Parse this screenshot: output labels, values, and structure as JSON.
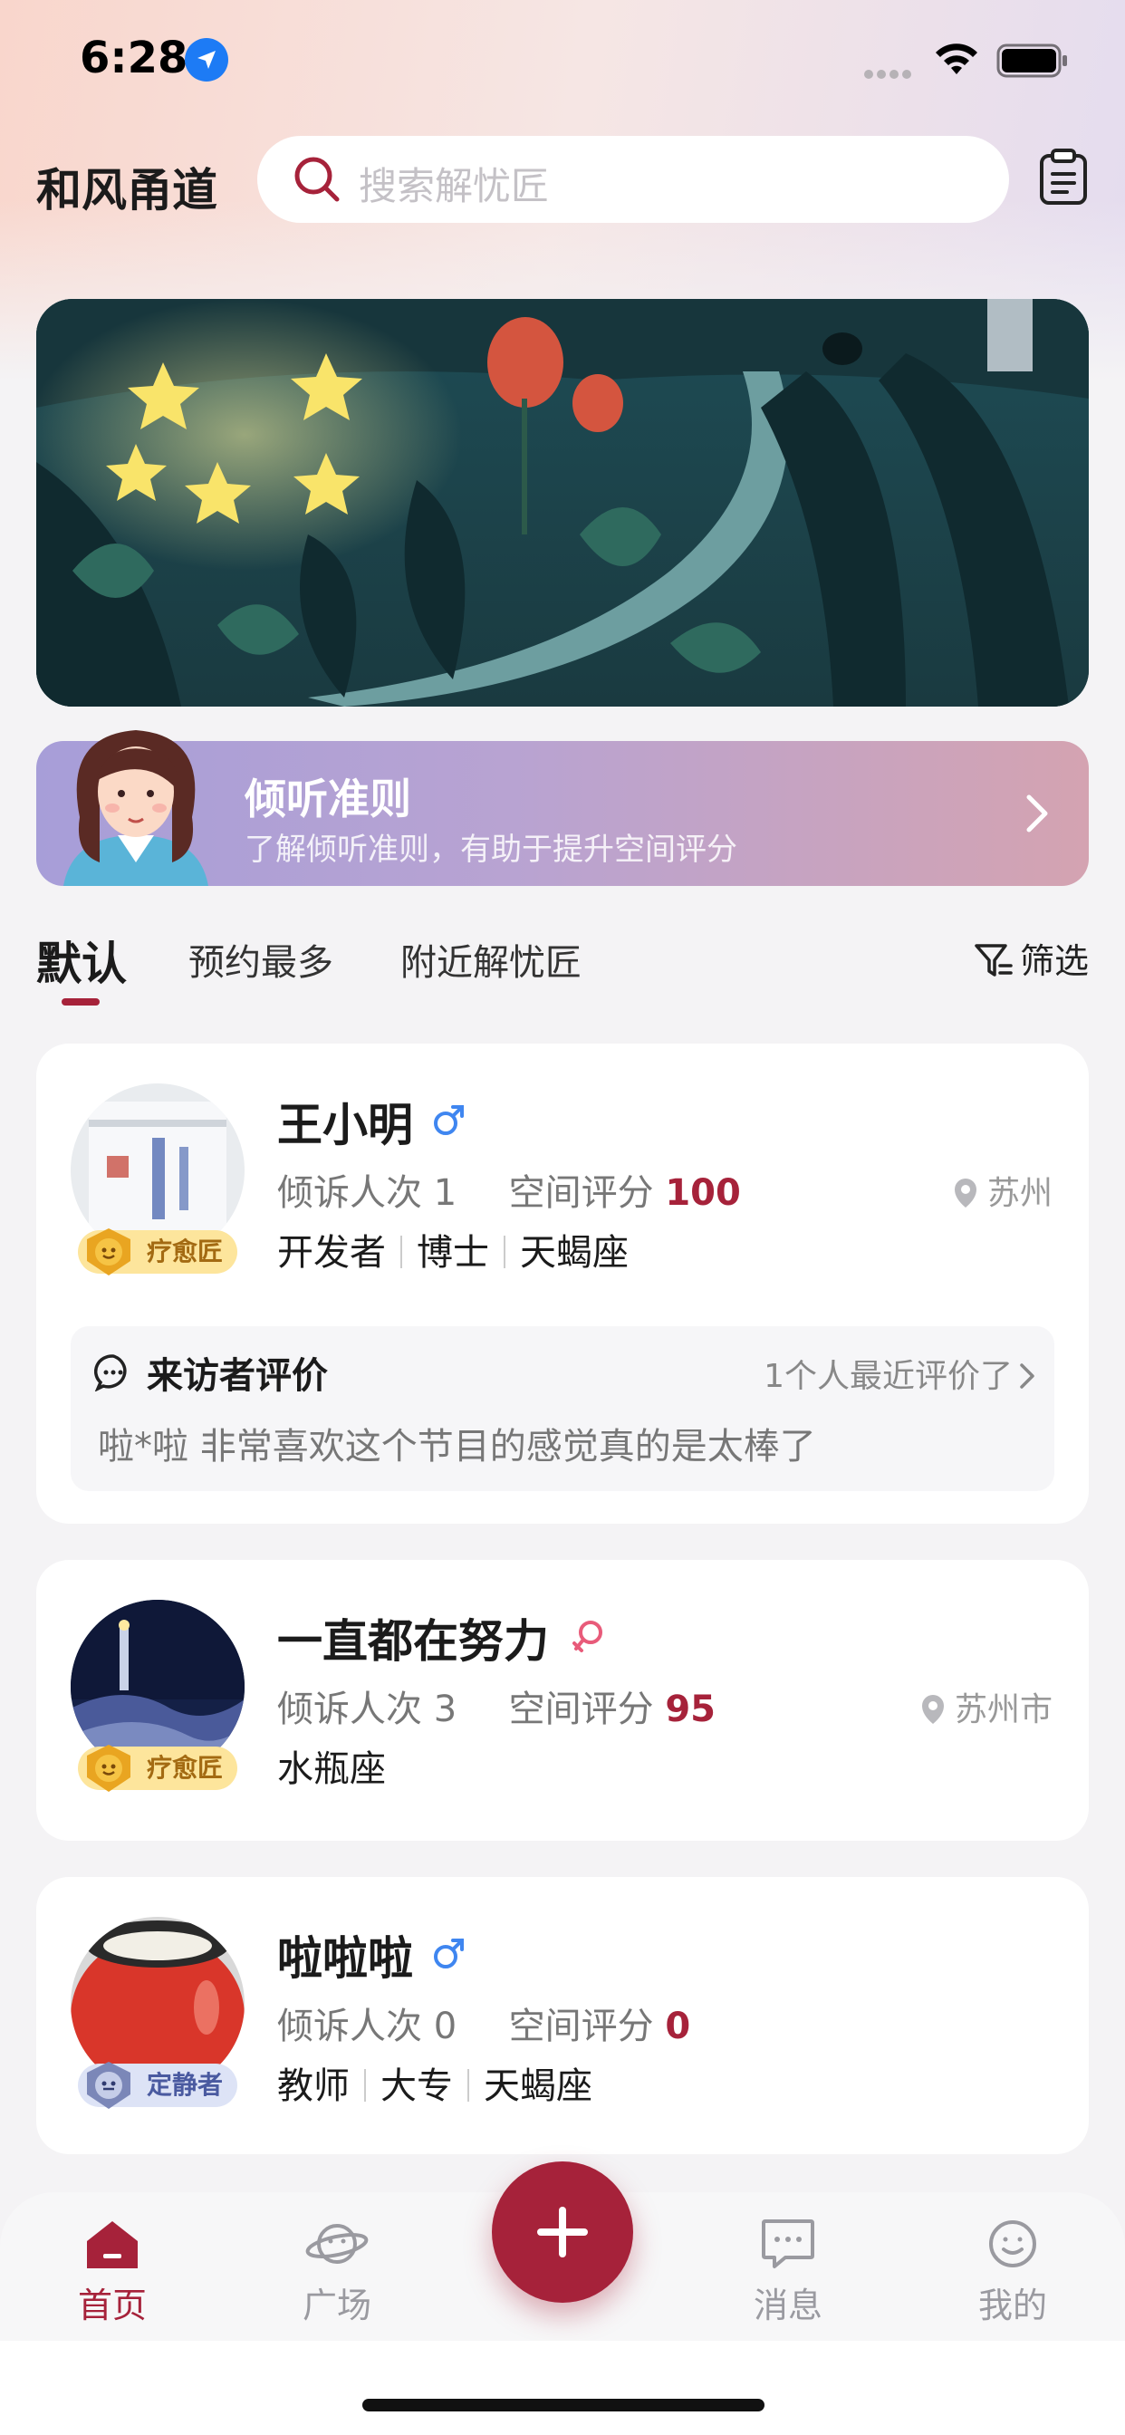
{
  "status_bar": {
    "time": "6:28"
  },
  "header": {
    "app_title": "和风甬道",
    "search_placeholder": "搜索解忧匠"
  },
  "guide_card": {
    "title": "倾听准则",
    "subtitle": "了解倾听准则，有助于提升空间评分"
  },
  "tabs": {
    "items": [
      "默认",
      "预约最多",
      "附近解忧匠"
    ],
    "active_index": 0,
    "filter_label": "筛选"
  },
  "labels": {
    "talk_count": "倾诉人次",
    "space_score": "空间评分"
  },
  "listeners": [
    {
      "name": "王小明",
      "gender": "male",
      "badge": "疗愈匠",
      "talk_count": "1",
      "score": "100",
      "location": "苏州",
      "tags": [
        "开发者",
        "博士",
        "天蝎座"
      ],
      "review": {
        "title": "来访者评价",
        "count_text": "1个人最近评价了",
        "text": "啦*啦 非常喜欢这个节目的感觉真的是太棒了"
      }
    },
    {
      "name": "一直都在努力",
      "gender": "female",
      "badge": "疗愈匠",
      "talk_count": "3",
      "score": "95",
      "location": "苏州市",
      "tags": [
        "水瓶座"
      ]
    },
    {
      "name": "啦啦啦",
      "gender": "male",
      "badge": "定静者",
      "talk_count": "0",
      "score": "0",
      "location": "",
      "tags": [
        "教师",
        "大专",
        "天蝎座"
      ]
    }
  ],
  "bottom_nav": {
    "items": [
      {
        "label": "首页",
        "icon": "home-icon"
      },
      {
        "label": "广场",
        "icon": "planet-icon"
      },
      {
        "label": "消息",
        "icon": "message-icon"
      },
      {
        "label": "我的",
        "icon": "profile-icon"
      }
    ],
    "active_index": 0,
    "fab_icon": "plus-icon"
  },
  "colors": {
    "accent": "#a6223a",
    "male": "#3f86f0",
    "female": "#e85b7a"
  }
}
